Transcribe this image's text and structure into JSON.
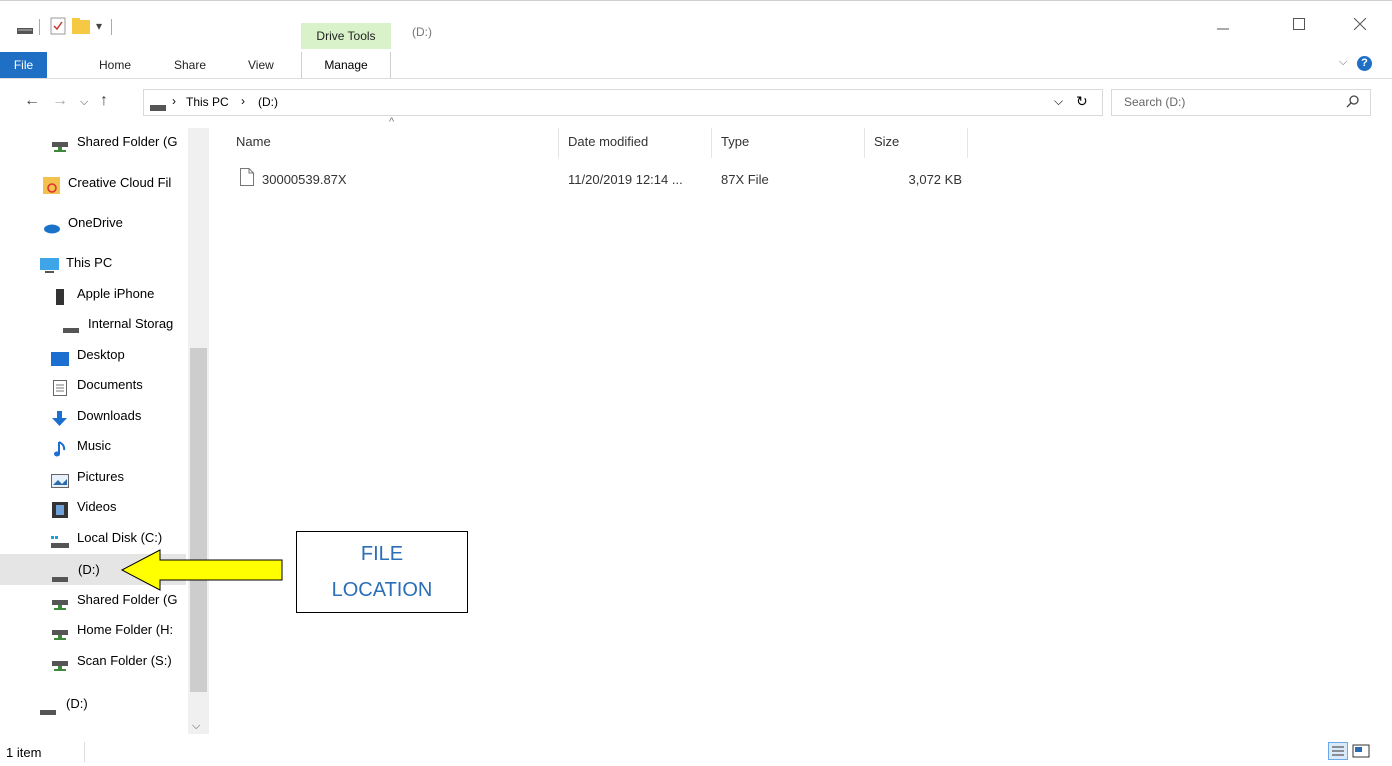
{
  "titlebar": {
    "context_tab": "Drive Tools",
    "window_title": "(D:)",
    "minimize_icon": "minimize-icon",
    "maximize_icon": "maximize-icon",
    "close_icon": "close-icon"
  },
  "ribbon": {
    "tabs": [
      "File",
      "Home",
      "Share",
      "View",
      "Manage"
    ],
    "help_icon": "help-icon"
  },
  "address": {
    "crumbs": [
      "This PC",
      "(D:)"
    ],
    "search_placeholder": "Search (D:)"
  },
  "nav": {
    "items": [
      {
        "label": "Shared Folder (G",
        "icon": "network-drive-icon"
      },
      {
        "label": "Creative Cloud Fil",
        "icon": "creative-cloud-icon"
      },
      {
        "label": "OneDrive",
        "icon": "onedrive-icon"
      },
      {
        "label": "This PC",
        "icon": "computer-icon"
      },
      {
        "label": "Apple iPhone",
        "icon": "phone-icon"
      },
      {
        "label": "Internal Storag",
        "icon": "drive-icon"
      },
      {
        "label": "Desktop",
        "icon": "desktop-icon"
      },
      {
        "label": "Documents",
        "icon": "documents-icon"
      },
      {
        "label": "Downloads",
        "icon": "downloads-icon"
      },
      {
        "label": "Music",
        "icon": "music-icon"
      },
      {
        "label": "Pictures",
        "icon": "pictures-icon"
      },
      {
        "label": "Videos",
        "icon": "videos-icon"
      },
      {
        "label": "Local Disk (C:)",
        "icon": "local-disk-icon"
      },
      {
        "label": "(D:)",
        "icon": "drive-icon"
      },
      {
        "label": "Shared Folder (G",
        "icon": "network-drive-icon"
      },
      {
        "label": "Home Folder (H:",
        "icon": "network-drive-icon"
      },
      {
        "label": "Scan Folder (S:)",
        "icon": "network-drive-icon"
      },
      {
        "label": "(D:)",
        "icon": "drive-icon"
      }
    ],
    "selected_index": 13
  },
  "files": {
    "columns": [
      "Name",
      "Date modified",
      "Type",
      "Size"
    ],
    "rows": [
      {
        "name": "30000539.87X",
        "date": "11/20/2019 12:14 ...",
        "type": "87X File",
        "size": "3,072 KB"
      }
    ]
  },
  "status": {
    "item_count": "1 item"
  },
  "annotation": {
    "line1": "FILE",
    "line2": "LOCATION",
    "arrow_color": "#ffff00"
  }
}
